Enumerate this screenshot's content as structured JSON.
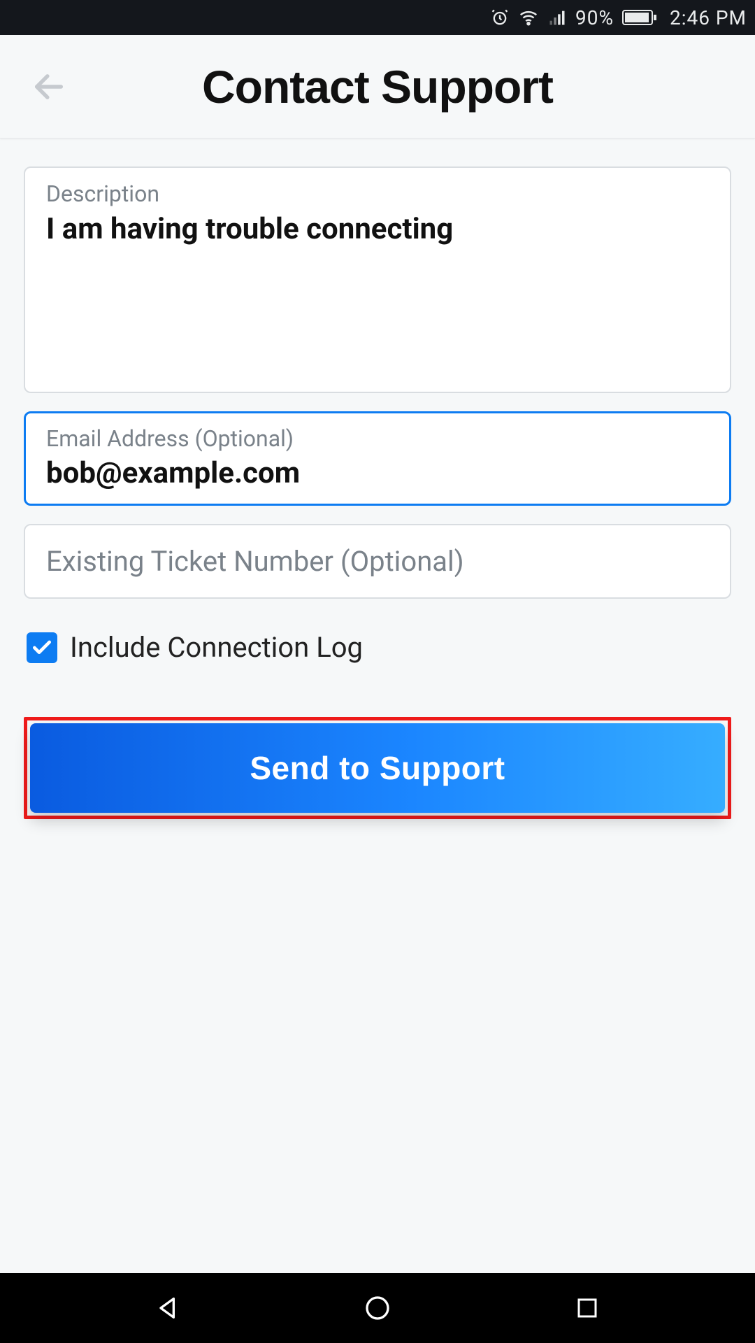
{
  "status": {
    "battery_pct": "90%",
    "time": "2:46 PM"
  },
  "header": {
    "title": "Contact Support"
  },
  "form": {
    "description": {
      "label": "Description",
      "value": "I am having trouble connecting"
    },
    "email": {
      "label": "Email Address (Optional)",
      "value": "bob@example.com"
    },
    "ticket": {
      "placeholder": "Existing Ticket Number (Optional)",
      "value": ""
    },
    "include_log": {
      "label": "Include Connection Log",
      "checked": true
    },
    "submit_label": "Send to Support"
  }
}
